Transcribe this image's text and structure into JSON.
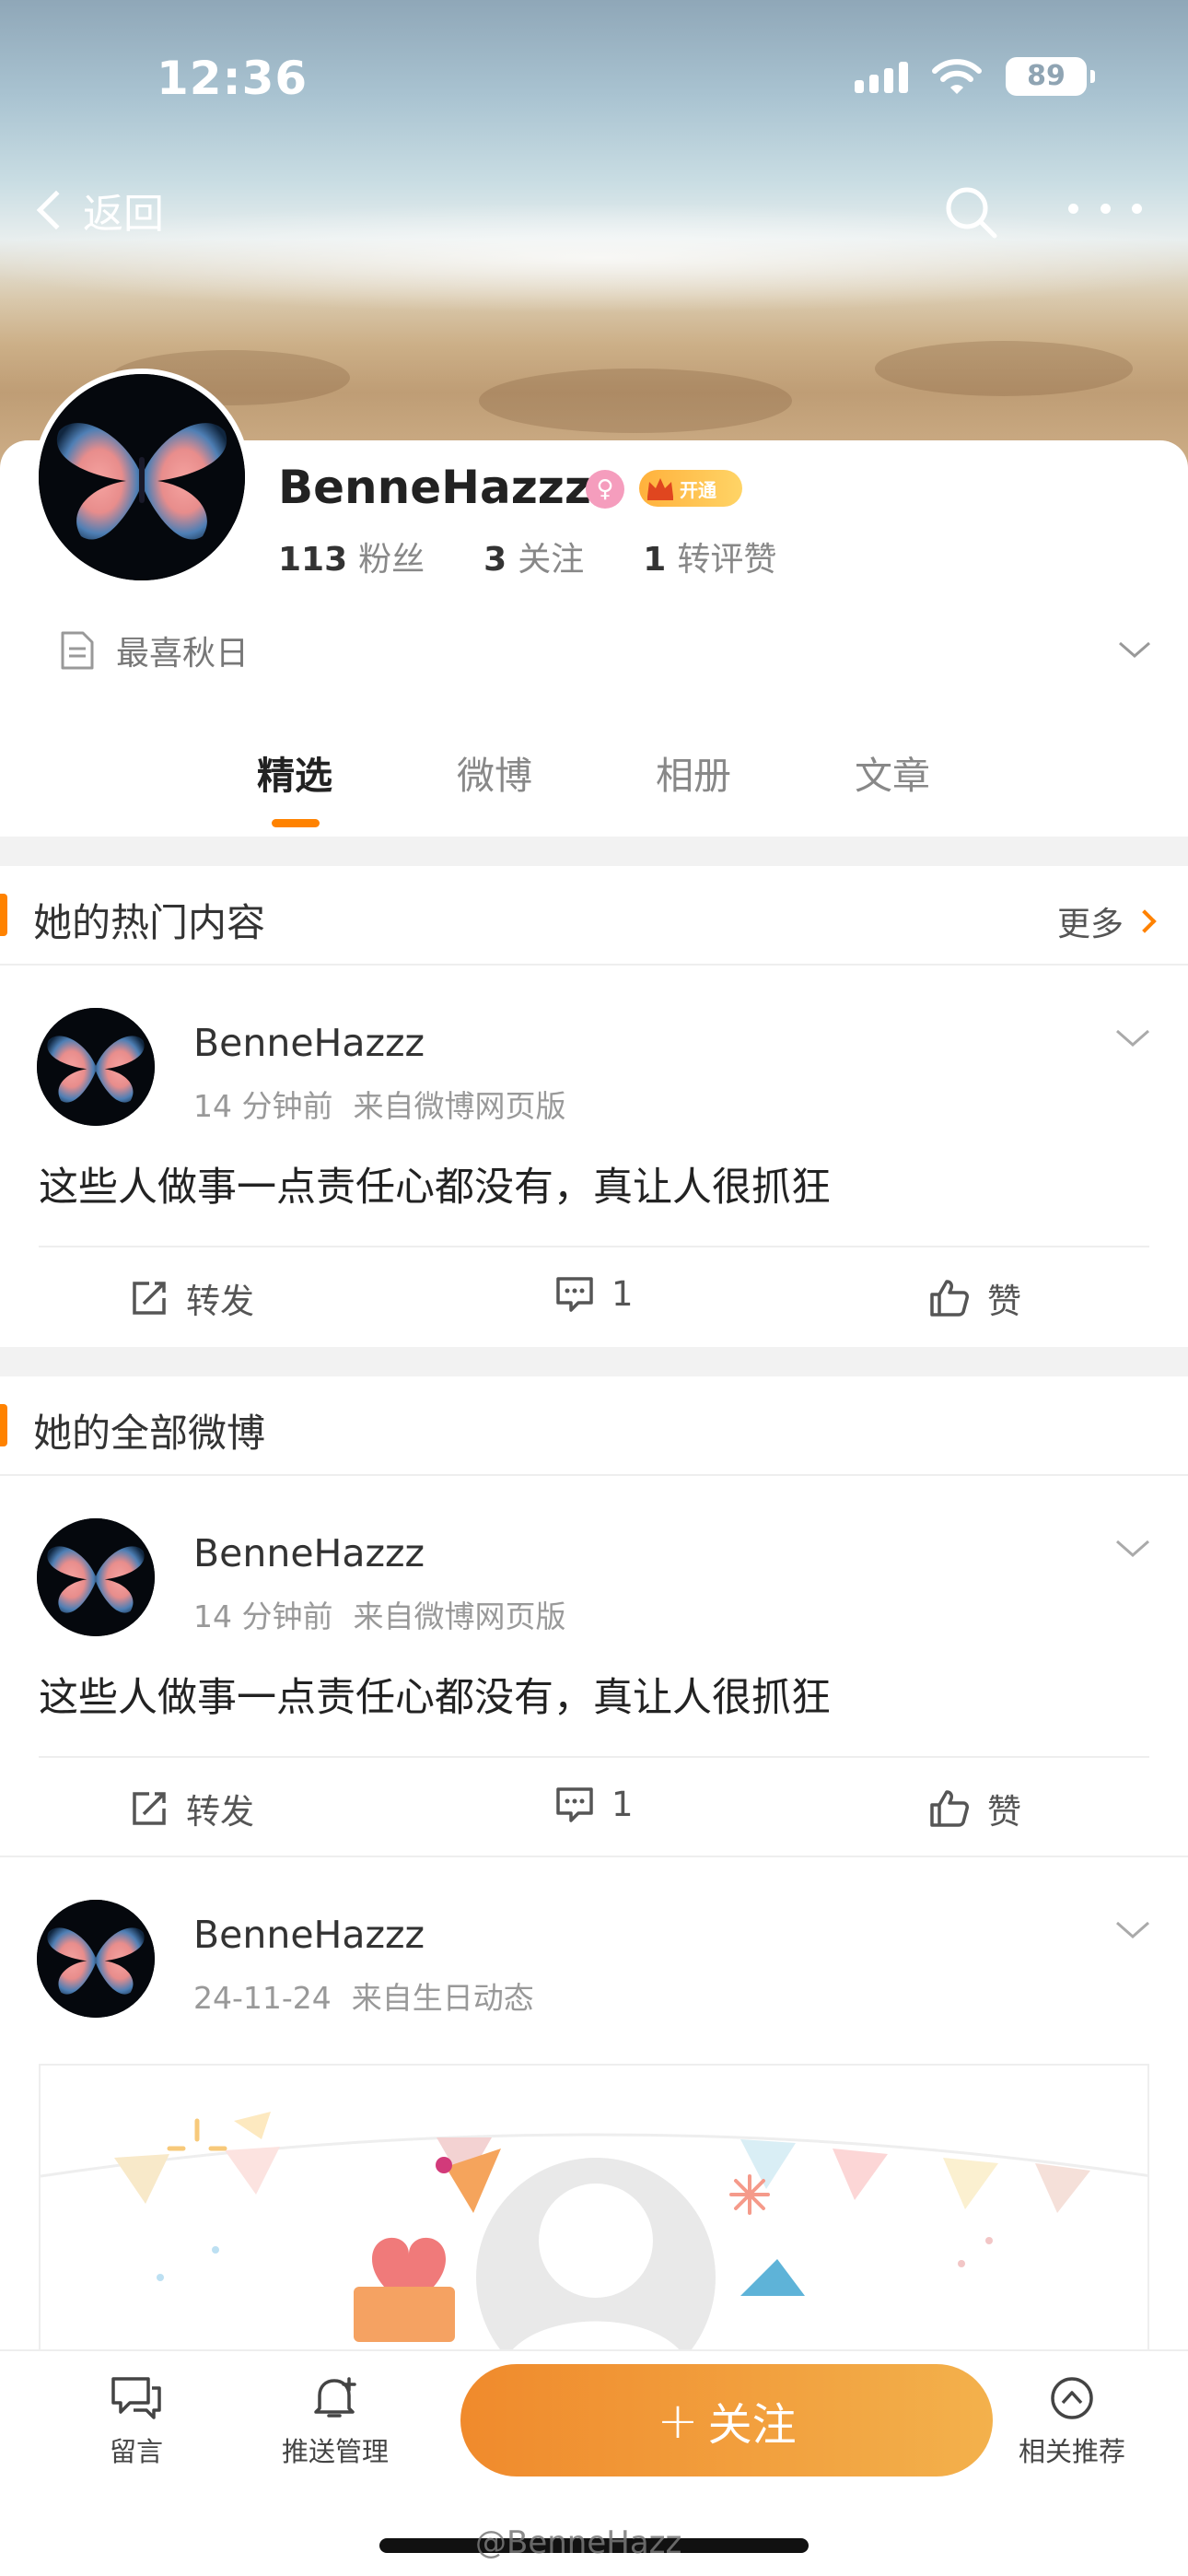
{
  "status_bar": {
    "time": "12:36",
    "battery": "89"
  },
  "nav": {
    "back_label": "返回"
  },
  "profile": {
    "name": "BenneHazzz",
    "vip_label": "开通",
    "stats": [
      {
        "num": "113",
        "label": "粉丝"
      },
      {
        "num": "3",
        "label": "关注"
      },
      {
        "num": "1",
        "label": "转评赞"
      }
    ],
    "bio": "最喜秋日"
  },
  "tabs": [
    "精选",
    "微博",
    "相册",
    "文章"
  ],
  "hot_section": {
    "title": "她的热门内容",
    "more_label": "更多"
  },
  "all_section": {
    "title": "她的全部微博"
  },
  "posts": [
    {
      "author": "BenneHazzz",
      "time": "14 分钟前",
      "source": "来自微博网页版",
      "text": "这些人做事一点责任心都没有，真让人很抓狂",
      "repost_label": "转发",
      "comment_count": "1",
      "like_label": "赞"
    },
    {
      "author": "BenneHazzz",
      "time": "14 分钟前",
      "source": "来自微博网页版",
      "text": "这些人做事一点责任心都没有，真让人很抓狂",
      "repost_label": "转发",
      "comment_count": "1",
      "like_label": "赞"
    },
    {
      "author": "BenneHazzz",
      "time": "24-11-24",
      "source": "来自生日动态"
    }
  ],
  "bottom_bar": {
    "message_label": "留言",
    "push_label": "推送管理",
    "follow_label": "关注",
    "recommend_label": "相关推荐"
  },
  "watermark": "@BenneHazz",
  "colors": {
    "accent": "#ff8200",
    "follow_start": "#f08a2c",
    "follow_end": "#f3b14c"
  }
}
